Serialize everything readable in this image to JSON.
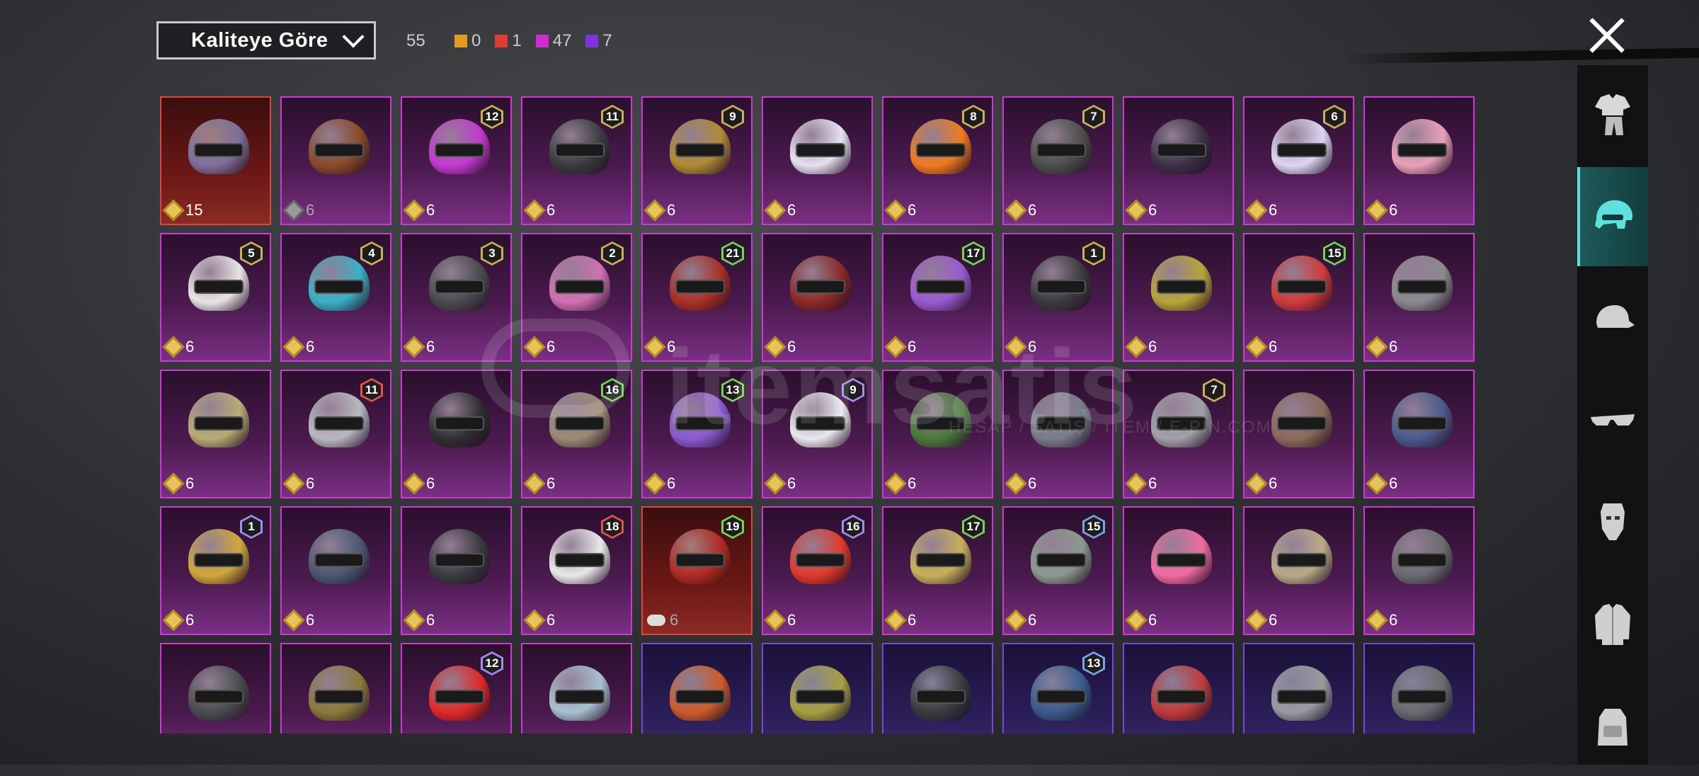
{
  "sort": {
    "label": "Kaliteye Göre"
  },
  "counts": {
    "total": "55",
    "items": [
      {
        "color": "#e39a1f",
        "value": "0"
      },
      {
        "color": "#e23a34",
        "value": "1"
      },
      {
        "color": "#d32ad0",
        "value": "47"
      },
      {
        "color": "#7a35e0",
        "value": "7"
      }
    ]
  },
  "watermark": {
    "brand": "itemsatis",
    "sub": "HESAP / SATIŞ / İTEM / E-PIN.COM"
  },
  "sidebar": [
    {
      "name": "outfit",
      "icon": "outfit-icon"
    },
    {
      "name": "helmet",
      "icon": "helmet-icon",
      "active": true
    },
    {
      "name": "hat",
      "icon": "cap-icon"
    },
    {
      "name": "eyewear",
      "icon": "glasses-icon"
    },
    {
      "name": "mask",
      "icon": "mask-icon"
    },
    {
      "name": "jacket",
      "icon": "jacket-icon"
    },
    {
      "name": "backpack",
      "icon": "backpack-icon"
    }
  ],
  "items": [
    {
      "tier": "red",
      "color": "#7d6f9c",
      "badge": "",
      "cost": "15"
    },
    {
      "tier": "magenta",
      "color": "#8a4a2a",
      "badge": "",
      "cost": "6",
      "coin": "bw"
    },
    {
      "tier": "magenta",
      "color": "#c23ad0",
      "badge": "12",
      "cost": "6"
    },
    {
      "tier": "magenta",
      "color": "#3a3a3e",
      "badge": "11",
      "cost": "6"
    },
    {
      "tier": "magenta",
      "color": "#b08a34",
      "badge": "9",
      "cost": "6"
    },
    {
      "tier": "magenta",
      "color": "#e6e0f0",
      "badge": "",
      "cost": "6"
    },
    {
      "tier": "magenta",
      "color": "#f07a1e",
      "badge": "8",
      "cost": "6"
    },
    {
      "tier": "magenta",
      "color": "#4a4e4a",
      "badge": "7",
      "cost": "6"
    },
    {
      "tier": "magenta",
      "color": "#3c3046",
      "badge": "",
      "cost": "6"
    },
    {
      "tier": "magenta",
      "color": "#dcd6f0",
      "badge": "6",
      "cost": "6"
    },
    {
      "tier": "magenta",
      "color": "#e8a0b8",
      "badge": "",
      "cost": "6"
    },
    {
      "tier": "magenta",
      "color": "#e8e4e6",
      "badge": "5",
      "cost": "6"
    },
    {
      "tier": "magenta",
      "color": "#3ab0c4",
      "badge": "4",
      "cost": "6"
    },
    {
      "tier": "magenta",
      "color": "#4a4a4e",
      "badge": "3",
      "cost": "6"
    },
    {
      "tier": "magenta",
      "color": "#d070b0",
      "badge": "2",
      "cost": "6"
    },
    {
      "tier": "magenta",
      "color": "#a83026",
      "badge": "21",
      "badgeStyle": "green",
      "cost": "6"
    },
    {
      "tier": "magenta",
      "color": "#8a2a26",
      "badge": "",
      "cost": "6"
    },
    {
      "tier": "magenta",
      "color": "#9a5ad0",
      "badge": "17",
      "badgeStyle": "green",
      "cost": "6"
    },
    {
      "tier": "magenta",
      "color": "#3a3a3e",
      "badge": "1",
      "cost": "6"
    },
    {
      "tier": "magenta",
      "color": "#b8a438",
      "badge": "",
      "cost": "6"
    },
    {
      "tier": "magenta",
      "color": "#d03a3a",
      "badge": "15",
      "badgeStyle": "green",
      "cost": "6"
    },
    {
      "tier": "magenta",
      "color": "#8a8a8e",
      "badge": "",
      "cost": "6"
    },
    {
      "tier": "magenta",
      "color": "#b8ab74",
      "badge": "",
      "cost": "6"
    },
    {
      "tier": "magenta",
      "color": "#b8b8c0",
      "badge": "11",
      "badgeStyle": "red",
      "cost": "6"
    },
    {
      "tier": "magenta",
      "color": "#2e2e30",
      "badge": "",
      "cost": "6"
    },
    {
      "tier": "magenta",
      "color": "#9a8a74",
      "badge": "16",
      "badgeStyle": "green",
      "cost": "6"
    },
    {
      "tier": "magenta",
      "color": "#8a5ad0",
      "badge": "13",
      "badgeStyle": "green",
      "cost": "6"
    },
    {
      "tier": "magenta",
      "color": "#e8e8ec",
      "badge": "9",
      "badgeStyle": "violet",
      "cost": "6"
    },
    {
      "tier": "magenta",
      "color": "#4a7a3a",
      "badge": "",
      "cost": "6"
    },
    {
      "tier": "magenta",
      "color": "#7a7c8a",
      "badge": "",
      "cost": "6"
    },
    {
      "tier": "magenta",
      "color": "#a0a0a8",
      "badge": "7",
      "cost": "6"
    },
    {
      "tier": "magenta",
      "color": "#8a6a5a",
      "badge": "",
      "cost": "6"
    },
    {
      "tier": "magenta",
      "color": "#4a5a8a",
      "badge": "",
      "cost": "6"
    },
    {
      "tier": "magenta",
      "color": "#d0a838",
      "badge": "1",
      "badgeStyle": "violet",
      "cost": "6"
    },
    {
      "tier": "magenta",
      "color": "#4a5870",
      "badge": "",
      "cost": "6"
    },
    {
      "tier": "magenta",
      "color": "#3a3a3e",
      "badge": "",
      "cost": "6"
    },
    {
      "tier": "magenta",
      "color": "#e8e8e8",
      "badge": "18",
      "badgeStyle": "red",
      "cost": "6"
    },
    {
      "tier": "red",
      "color": "#b02a24",
      "badge": "19",
      "badgeStyle": "green",
      "cost": "6",
      "coin": "cloud"
    },
    {
      "tier": "magenta",
      "color": "#e03a2a",
      "badge": "16",
      "badgeStyle": "violet",
      "cost": "6"
    },
    {
      "tier": "magenta",
      "color": "#c8b058",
      "badge": "17",
      "badgeStyle": "green",
      "cost": "6"
    },
    {
      "tier": "magenta",
      "color": "#8a9a8e",
      "badge": "15",
      "badgeStyle": "blue",
      "cost": "6"
    },
    {
      "tier": "magenta",
      "color": "#f06aa0",
      "badge": "",
      "cost": "6"
    },
    {
      "tier": "magenta",
      "color": "#b8aa88",
      "badge": "",
      "cost": "6"
    },
    {
      "tier": "magenta",
      "color": "#6a6c70",
      "badge": "",
      "cost": "6"
    },
    {
      "tier": "magenta",
      "color": "#4a4c50",
      "badge": "",
      "cost": ""
    },
    {
      "tier": "magenta",
      "color": "#8a7a3a",
      "badge": "",
      "cost": ""
    },
    {
      "tier": "magenta",
      "color": "#e02a2a",
      "badge": "12",
      "badgeStyle": "violet",
      "cost": ""
    },
    {
      "tier": "magenta",
      "color": "#a8c0d0",
      "badge": "",
      "cost": ""
    },
    {
      "tier": "purple",
      "color": "#d05a2a",
      "badge": "",
      "cost": ""
    },
    {
      "tier": "purple",
      "color": "#a8a040",
      "badge": "",
      "cost": ""
    },
    {
      "tier": "purple",
      "color": "#3a3a3e",
      "badge": "",
      "cost": ""
    },
    {
      "tier": "purple",
      "color": "#3a5a8a",
      "badge": "13",
      "badgeStyle": "blue",
      "cost": ""
    },
    {
      "tier": "purple",
      "color": "#c03a3a",
      "badge": "",
      "cost": ""
    },
    {
      "tier": "purple",
      "color": "#9a9aa0",
      "badge": "",
      "cost": ""
    },
    {
      "tier": "purple",
      "color": "#6a6a6e",
      "badge": "",
      "cost": ""
    }
  ]
}
